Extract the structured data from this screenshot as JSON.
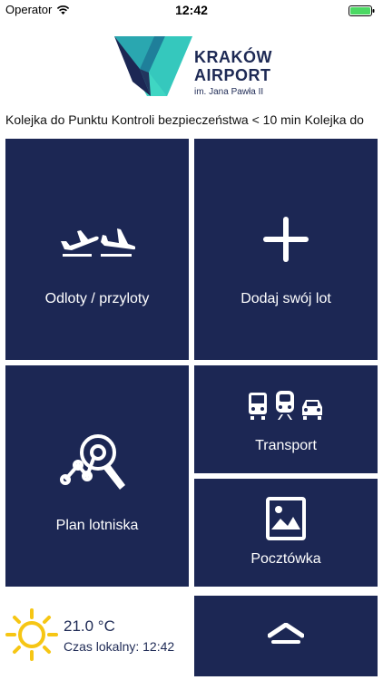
{
  "status_bar": {
    "carrier": "Operator",
    "time": "12:42",
    "wifi_icon": "wifi-icon",
    "battery_icon": "battery-icon",
    "battery_color": "#4cd964"
  },
  "logo": {
    "line1": "KRAKÓW",
    "line2": "AIRPORT",
    "line3": "im. Jana Pawła II",
    "colors": [
      "#3fd6c3",
      "#1f7f9a",
      "#1c2754"
    ]
  },
  "ticker": {
    "text": "Kolejka do Punktu Kontroli bezpieczeństwa < 10 min  Kolejka do"
  },
  "tiles": {
    "flights": {
      "label": "Odloty / przyloty",
      "icon": "plane-departure-arrival-icon"
    },
    "add_flight": {
      "label": "Dodaj swój lot",
      "icon": "plus-icon"
    },
    "plan": {
      "label": "Plan lotniska",
      "icon": "map-search-icon"
    },
    "transport": {
      "label": "Transport",
      "icon": "bus-train-car-icon"
    },
    "postcard": {
      "label": "Pocztówka",
      "icon": "postcard-icon"
    },
    "up": {
      "icon": "chevron-up-icon"
    }
  },
  "weather": {
    "temperature": "21.0 °C",
    "local_time": "Czas lokalny: 12:42",
    "icon": "sun-icon",
    "sun_color": "#f6c614"
  },
  "colors": {
    "tile_bg": "#1c2754",
    "text_dark": "#1e2a55"
  }
}
